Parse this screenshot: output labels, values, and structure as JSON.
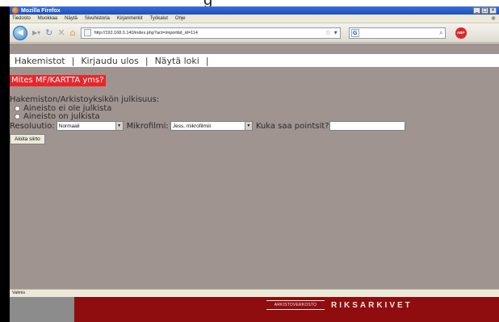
{
  "slide": {
    "caption": "g",
    "logo_seal": "ARKISTOVERKOSTO",
    "logo_brand": "RIKSARKIVET"
  },
  "window": {
    "title": "Mozilla Firefox",
    "buttons": [
      "_",
      "□",
      "×"
    ]
  },
  "menu": [
    "Tiedosto",
    "Muokkaa",
    "Näytä",
    "Sivuhistoria",
    "Kirjanmerkit",
    "Työkalut",
    "Ohje"
  ],
  "address": {
    "url": "http://192.168.0.140/index.php?act=importtid_id=114"
  },
  "search": {
    "engine": "G"
  },
  "nav_links": [
    "Hakemistot",
    "Kirjaudu ulos",
    "Näytä loki"
  ],
  "red_link": "Mites MF/KARTTA yms?",
  "visibility": {
    "label": "Hakemiston/Arkistoyksikön julkisuus:",
    "options": [
      "Aineisto ei ole julkista",
      "Aineisto on julkista"
    ]
  },
  "form": {
    "resolution_label": "Resoluutio:",
    "resolution_value": "Normaali",
    "microfilm_label": "Mikrofilmi:",
    "microfilm_value": "Jess, mikrofilmiii",
    "points_label": "Kuka saa pointsit?",
    "points_value": "",
    "submit_label": "Aloita siirto"
  },
  "status": "Valmis",
  "colors": {
    "content_bg": "#a09491",
    "red_link_bg": "#e8262a",
    "footer_red": "#8f0d0e"
  }
}
